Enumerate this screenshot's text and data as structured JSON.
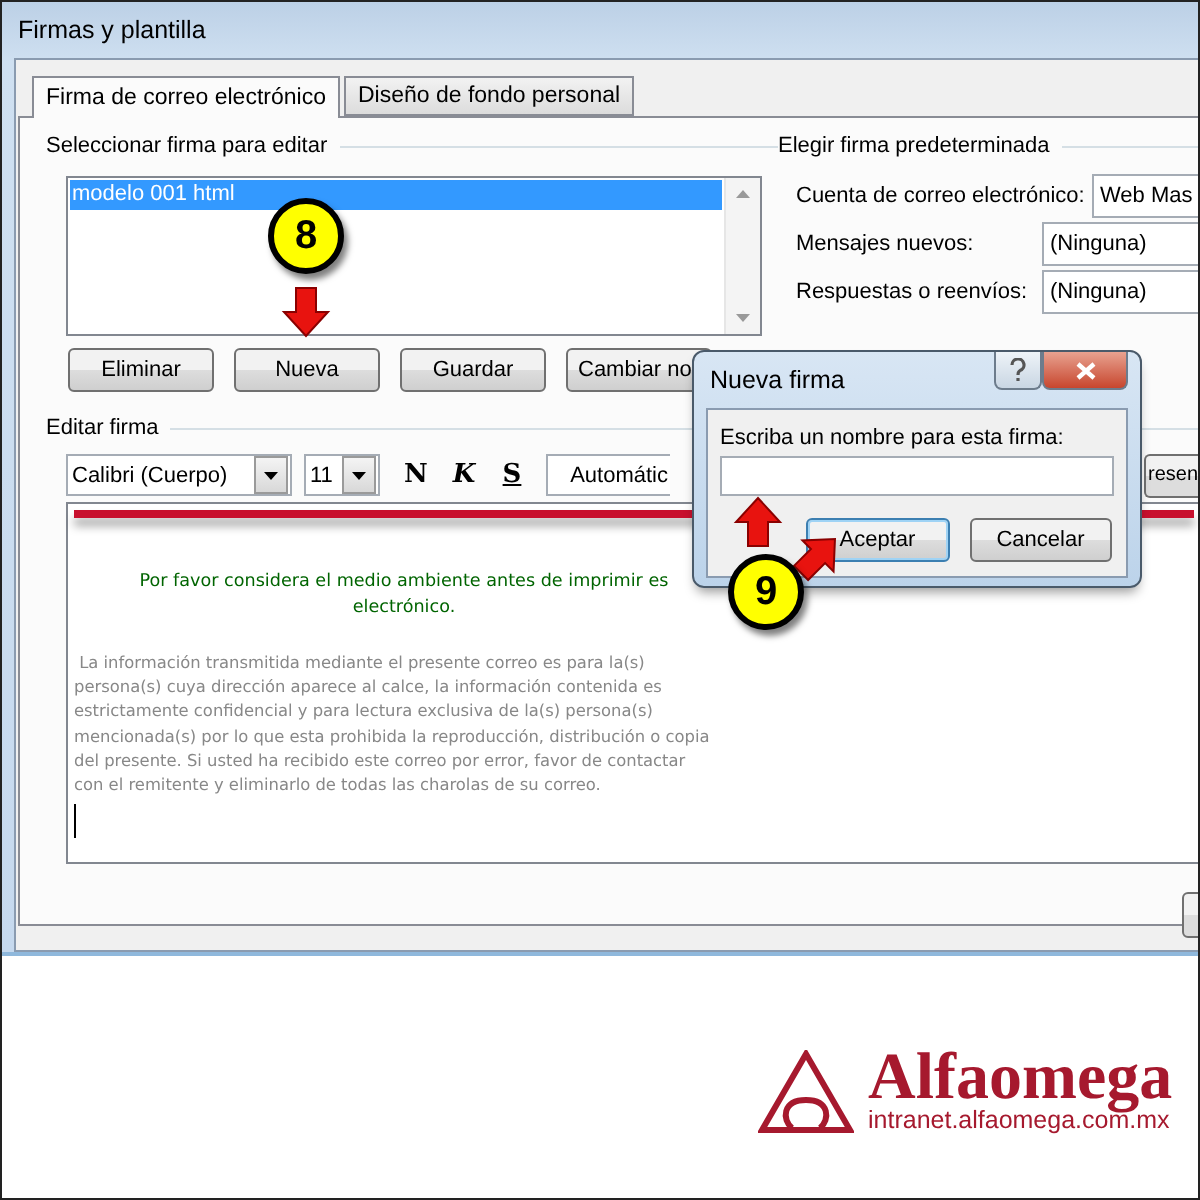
{
  "window": {
    "title": "Firmas y plantilla"
  },
  "tabs": [
    {
      "label": "Firma de correo electrónico",
      "selected": true
    },
    {
      "label": "Diseño de fondo personal",
      "selected": false
    }
  ],
  "select_signature": {
    "heading": "Seleccionar firma para editar",
    "items": [
      {
        "label": "modelo 001 html",
        "selected": true
      }
    ],
    "buttons": [
      "Eliminar",
      "Nueva",
      "Guardar",
      "Cambiar no"
    ]
  },
  "default_signature": {
    "heading": "Elegir firma predeterminada",
    "rows": [
      {
        "label": "Cuenta de correo electrónico:",
        "value": "Web Mas"
      },
      {
        "label": "Mensajes nuevos:",
        "value": "(Ninguna)"
      },
      {
        "label": "Respuestas o reenvíos:",
        "value": "(Ninguna)"
      }
    ]
  },
  "edit_signature": {
    "heading": "Editar firma",
    "font": "Calibri (Cuerpo)",
    "size": "11",
    "format_buttons": [
      {
        "label": "N",
        "kind": "bold"
      },
      {
        "label": "K",
        "kind": "italic"
      },
      {
        "label": "S",
        "kind": "underline"
      }
    ],
    "font_color": "Automátic",
    "side_button": "resen",
    "notice_lines": [
      "Por favor considera el medio ambiente antes de imprimir es",
      "electrónico."
    ],
    "disclaimer_lines": [
      " La información transmitida mediante el presente correo es para la(s)",
      "persona(s) cuya dirección aparece al calce, la información contenida es",
      "estrictamente confidencial y para lectura exclusiva de la(s) persona(s)",
      "mencionada(s) por lo que esta prohibida la reproducción, distribución o copia",
      "del presente. Si usted ha recibido este correo por error, favor de contactar",
      "con el remitente y eliminarlo de todas las charolas de su correo."
    ]
  },
  "dialog": {
    "title": "Nueva firma",
    "prompt": "Escriba un nombre para esta firma:",
    "buttons": [
      {
        "label": "Aceptar",
        "default": true
      },
      {
        "label": "Cancelar",
        "default": false
      }
    ]
  },
  "callouts": [
    {
      "number": "8"
    },
    {
      "number": "9"
    }
  ],
  "brand": {
    "name": "Alfaomega",
    "url": "intranet.alfaomega.com.mx"
  }
}
